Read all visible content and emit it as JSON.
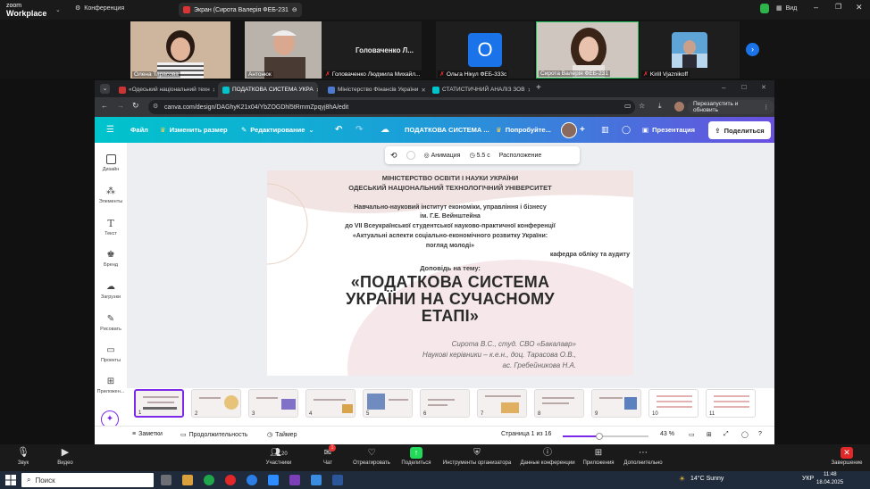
{
  "zoom_top": {
    "logo_line1": "zoom",
    "logo_line2": "Workplace",
    "conference_label": "Конференция",
    "screen_share_label": "Экран (Сирота Валерія ФЕБ-231",
    "view_label": "Вид"
  },
  "participants": [
    {
      "name": "Олена Тарасова",
      "muted": false
    },
    {
      "name": "Антонюк",
      "muted": false
    },
    {
      "name": "Головаченко Людмила Михайл...",
      "muted": true,
      "display_text": "Головаченко Л..."
    },
    {
      "name": "Ольга Нікул ФЕБ-333с",
      "muted": true,
      "initial": "O"
    },
    {
      "name": "Сирота Валерія ФЕБ-231",
      "muted": false
    },
    {
      "name": "Kirill Vjaznikoff",
      "muted": true
    }
  ],
  "browser": {
    "tabs": [
      {
        "label": "«Одеський національний техн",
        "active": false
      },
      {
        "label": "ПОДАТКОВА СИСТЕМА УКРА",
        "active": true
      },
      {
        "label": "Міністерство Фінансів України",
        "active": false
      },
      {
        "label": "СТАТИСТИЧНИЙ АНАЛІЗ ЗОВ",
        "active": false
      }
    ],
    "url": "canva.com/design/DAGhyK21x04/YbZOGDhl5tRmmZpqyj8hA/edit",
    "relaunch_label": "Перезапустить и обновить"
  },
  "canva": {
    "toolbar": {
      "file": "Файл",
      "resize": "Изменить размер",
      "editing": "Редактирование",
      "title": "ПОДАТКОВА СИСТЕМА ...",
      "try_label": "Попробуйте...",
      "present": "Презентация",
      "share": "Поделиться"
    },
    "rail": [
      "Дизайн",
      "Элементы",
      "Текст",
      "Бренд",
      "Загрузки",
      "Рисовать",
      "Проекты",
      "Приложен..."
    ],
    "context_bar": {
      "animation": "Анимация",
      "duration": "5.5 с",
      "position": "Расположение"
    },
    "slide": {
      "ministry": "МІНІСТЕРСТВО ОСВІТИ І НАУКИ УКРАЇНИ",
      "university": "ОДЕСЬКИЙ НАЦІОНАЛЬНИЙ ТЕХНОЛОГІЧНИЙ УНІВЕРСИТЕТ",
      "institute_1": "Навчально-науковий інститут економіки, управління і бізнесу",
      "institute_2": "ім. Г.Е. Вейнштейна",
      "conf_1": "до VII Всеукраїнської студентської науково-практичної конференції",
      "conf_2": "«Актуальні аспекти соціально-економічного розвитку України:",
      "conf_3": "погляд молоді»",
      "department": "кафедра обліку та аудиту",
      "report": "Доповідь на тему:",
      "topic_1": "«ПОДАТКОВА СИСТЕМА",
      "topic_2": "УКРАЇНИ НА СУЧАСНОМУ",
      "topic_3": "ЕТАПІ»",
      "author": "Сирота В.С., студ. СВО «Бакалавр»",
      "advisor_1": "Наукові керівники – к.е.н., доц. Тарасова О.В.,",
      "advisor_2": "ас. Гребейникова Н.А."
    },
    "pages": [
      "1",
      "2",
      "3",
      "4",
      "5",
      "6",
      "7",
      "8",
      "9",
      "10",
      "11"
    ],
    "bottom": {
      "notes": "Заметки",
      "duration": "Продолжительность",
      "timer": "Таймер",
      "page": "Страница 1 из 16",
      "zoom": "43 %",
      "zoom_fraction": 0.43
    }
  },
  "zoom_controls": {
    "audio": "Звук",
    "video": "Видео",
    "participants": "Участники",
    "participants_count": "20",
    "chat": "Чат",
    "chat_badge": "1",
    "react": "Отреагировать",
    "share": "Поделиться",
    "host_tools": "Инструменты организатора",
    "meeting_info": "Данные конференции",
    "apps": "Приложения",
    "more": "Дополнительно",
    "end": "Завершение"
  },
  "taskbar": {
    "search": "Поиск",
    "weather": "14°C  Sunny",
    "lang": "УКР",
    "time": "11:48",
    "date": "18.04.2025"
  },
  "colors": {
    "zoom_bg": "#1a1a1a",
    "canva_gradient_start": "#00c4cc",
    "canva_gradient_end": "#6a4fe0",
    "accent_purple": "#7d2ae8",
    "ms_blue": "#1a73e8",
    "share_green": "#23d959"
  }
}
